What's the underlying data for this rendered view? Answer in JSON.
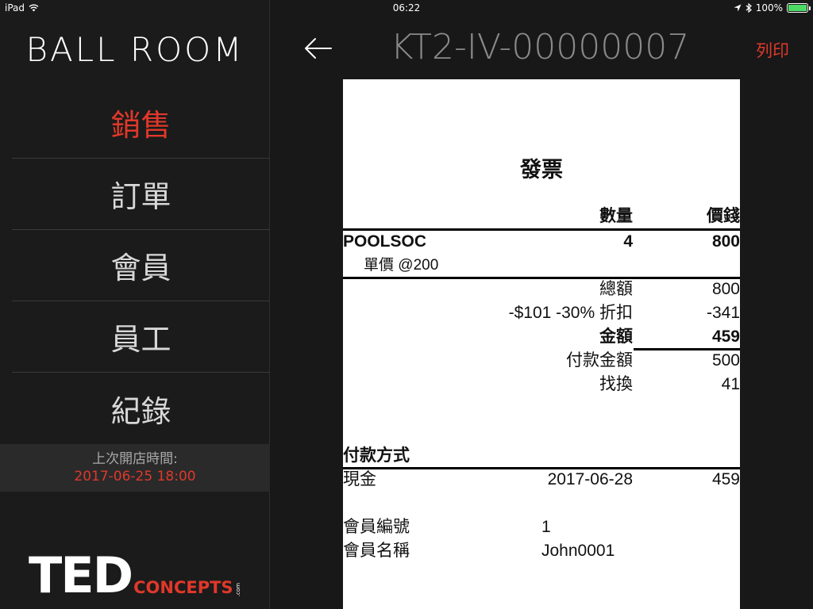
{
  "status": {
    "device": "iPad",
    "time": "06:22",
    "battery": "100%",
    "battery_level": 1.0
  },
  "sidebar": {
    "logo": "BALL ROOM",
    "items": [
      {
        "label": "銷售",
        "active": true
      },
      {
        "label": "訂單",
        "active": false
      },
      {
        "label": "會員",
        "active": false
      },
      {
        "label": "員工",
        "active": false
      },
      {
        "label": "紀錄",
        "active": false
      }
    ],
    "last_open_label": "上次開店時間:",
    "last_open_value": "2017-06-25 18:00",
    "brand_ted": "TED",
    "brand_concepts": "CONCEPTS",
    "brand_dotcom": ".com"
  },
  "header": {
    "title": "KT2-IV-00000007",
    "print_label": "列印"
  },
  "receipt": {
    "title": "發票",
    "col_qty": "數量",
    "col_price": "價錢",
    "item_name": "POOLSOC",
    "item_qty": "4",
    "item_price": "800",
    "unit_price": "單價 @200",
    "subtotal_label": "總額",
    "subtotal_value": "800",
    "discount_label": "-$101 -30% 折扣",
    "discount_value": "-341",
    "total_label": "金額",
    "total_value": "459",
    "paid_label": "付款金額",
    "paid_value": "500",
    "change_label": "找換",
    "change_value": "41",
    "payment_heading": "付款方式",
    "payment_method": "現金",
    "payment_date": "2017-06-28",
    "payment_amount": "459",
    "member_no_label": "會員編號",
    "member_no_value": "1",
    "member_name_label": "會員名稱",
    "member_name_value": "John0001"
  },
  "colors": {
    "accent": "#e0382a",
    "background": "#181818",
    "sidebar": "#1b1b1b",
    "battery": "#4cd964"
  }
}
